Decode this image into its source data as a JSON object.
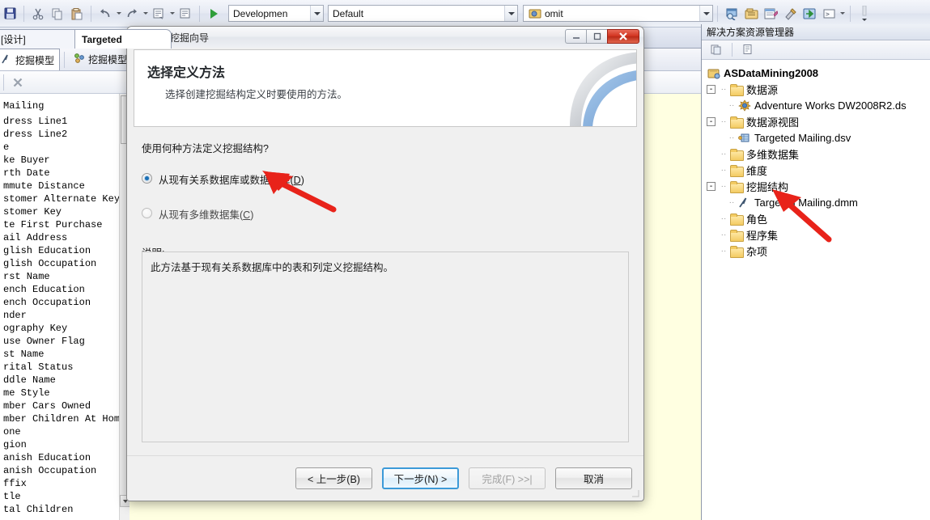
{
  "toolbar": {
    "icons": [
      "save-all-icon",
      "cut-icon",
      "copy-icon",
      "paste-icon",
      "undo-icon",
      "redo-icon",
      "comment-icon",
      "uncomment-icon",
      "start-debug-icon"
    ],
    "config_combo": {
      "value": "Developmen",
      "name": "solution-configuration-combo"
    },
    "platform_combo": {
      "value": "Default",
      "name": "solution-platform-combo"
    },
    "project_combo": {
      "value": "omit",
      "name": "project-combo"
    },
    "right_icons": [
      "properties-window-icon",
      "solution-explorer-icon",
      "object-browser-icon",
      "toolbox-icon",
      "deploy-icon",
      "command-window-icon"
    ]
  },
  "left_pane": {
    "tabs": [
      {
        "label": "ling.dsv [设计]",
        "active": false
      },
      {
        "label": "Targeted",
        "active": true
      }
    ],
    "designer_tabs": [
      {
        "label": "挖掘模型",
        "icon": "mining-structure-icon",
        "selected": true
      },
      {
        "label": "挖掘模型查",
        "icon": "mining-model-viewer-icon",
        "selected": false
      }
    ],
    "column_list_title": "Mailing",
    "columns": [
      "dress Line1",
      "dress Line2",
      "e",
      "ke Buyer",
      "rth Date",
      "mmute Distance",
      "stomer Alternate Key",
      "stomer Key",
      "te First Purchase",
      "ail Address",
      "glish Education",
      "glish Occupation",
      "rst Name",
      "ench Education",
      "ench Occupation",
      "nder",
      "ography Key",
      "use Owner Flag",
      "st Name",
      "rital Status",
      "ddle Name",
      "me Style",
      "mber Cars Owned",
      "mber Children At Home",
      "one",
      "gion",
      "anish Education",
      "anish Occupation",
      "ffix",
      "tle",
      "tal Children"
    ]
  },
  "solution_explorer": {
    "title": "解决方案资源管理器",
    "toolbar_icons": [
      "show-all-files-icon",
      "properties-icon"
    ],
    "tree": [
      {
        "label": "ASDataMining2008",
        "icon": "project-icon",
        "depth": 0,
        "expander": "",
        "bold": true
      },
      {
        "label": "数据源",
        "icon": "folder-icon",
        "depth": 1,
        "expander": "-"
      },
      {
        "label": "Adventure Works DW2008R2.ds",
        "icon": "datasource-icon",
        "depth": 2,
        "expander": ""
      },
      {
        "label": "数据源视图",
        "icon": "folder-icon",
        "depth": 1,
        "expander": "-"
      },
      {
        "label": "Targeted Mailing.dsv",
        "icon": "dsv-icon",
        "depth": 2,
        "expander": ""
      },
      {
        "label": "多维数据集",
        "icon": "folder-icon",
        "depth": 1,
        "expander": ""
      },
      {
        "label": "维度",
        "icon": "folder-icon",
        "depth": 1,
        "expander": ""
      },
      {
        "label": "挖掘结构",
        "icon": "folder-icon",
        "depth": 1,
        "expander": "-"
      },
      {
        "label": "Targeted Mailing.dmm",
        "icon": "mining-structure-icon",
        "depth": 2,
        "expander": ""
      },
      {
        "label": "角色",
        "icon": "folder-icon",
        "depth": 1,
        "expander": ""
      },
      {
        "label": "程序集",
        "icon": "folder-icon",
        "depth": 1,
        "expander": ""
      },
      {
        "label": "杂项",
        "icon": "folder-icon",
        "depth": 1,
        "expander": ""
      }
    ]
  },
  "dialog": {
    "title": "数据挖掘向导",
    "title_icon": "mining-structure-icon",
    "window_buttons": {
      "minimize": "–",
      "maximize": "□",
      "close": "✕"
    },
    "heading": "选择定义方法",
    "subheading": "选择创建挖掘结构定义时要使用的方法。",
    "question": "使用何种方法定义挖掘结构?",
    "options": [
      {
        "label_pre": "从现有关系数据库或数据仓库(",
        "accel": "D",
        "label_post": ")",
        "selected": true
      },
      {
        "label_pre": "从现有多维数据集(",
        "accel": "C",
        "label_post": ")",
        "selected": false
      }
    ],
    "description_label": "说明:",
    "description_text": "此方法基于现有关系数据库中的表和列定义挖掘结构。",
    "buttons": [
      {
        "label": "< 上一步(B)",
        "state": "normal",
        "name": "back-button"
      },
      {
        "label": "下一步(N) >",
        "state": "default",
        "name": "next-button"
      },
      {
        "label": "完成(F) >>|",
        "state": "disabled",
        "name": "finish-button"
      },
      {
        "label": "取消",
        "state": "normal",
        "name": "cancel-button"
      }
    ]
  },
  "annotations": {
    "arrow_color": "#e8231a",
    "arrows": [
      {
        "name": "annotation-arrow-radio",
        "points": "from (408,258) to (330,219)"
      },
      {
        "name": "annotation-arrow-tree",
        "points": "from (1022,292) to (958,238)"
      }
    ]
  }
}
